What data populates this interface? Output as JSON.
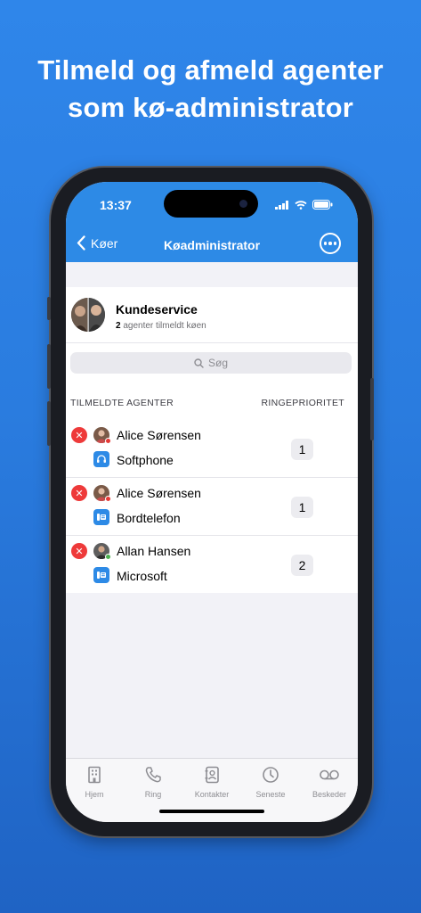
{
  "headline": {
    "line1": "Tilmeld og afmeld agenter",
    "line2": "som kø-administrator"
  },
  "status_bar": {
    "time": "13:37"
  },
  "nav": {
    "back_label": "Køer",
    "title": "Køadministrator",
    "more_icon": "ellipsis-circle-icon"
  },
  "queue": {
    "name": "Kundeservice",
    "agent_count": "2",
    "agent_suffix": "agenter tilmeldt køen"
  },
  "search": {
    "placeholder": "Søg"
  },
  "list": {
    "header_agents": "TILMELDTE AGENTER",
    "header_priority": "RINGEPRIORITET",
    "rows": [
      {
        "name": "Alice Sørensen",
        "device": "Softphone",
        "device_icon": "headset-icon",
        "priority": "1",
        "presence_color": "#e53935"
      },
      {
        "name": "Alice Sørensen",
        "device": "Bordtelefon",
        "device_icon": "desk-phone-icon",
        "priority": "1",
        "presence_color": "#e53935"
      },
      {
        "name": "Allan Hansen",
        "device": "Microsoft",
        "device_icon": "desk-phone-icon",
        "priority": "2",
        "presence_color": "#4caf50"
      }
    ]
  },
  "tabs": [
    {
      "label": "Hjem",
      "icon": "building-icon"
    },
    {
      "label": "Ring",
      "icon": "phone-icon"
    },
    {
      "label": "Kontakter",
      "icon": "contacts-book-icon"
    },
    {
      "label": "Seneste",
      "icon": "clock-icon"
    },
    {
      "label": "Beskeder",
      "icon": "voicemail-icon"
    }
  ],
  "colors": {
    "accent": "#2d8ae6",
    "remove": "#ee3a3a",
    "background_top": "#2f86ea"
  }
}
